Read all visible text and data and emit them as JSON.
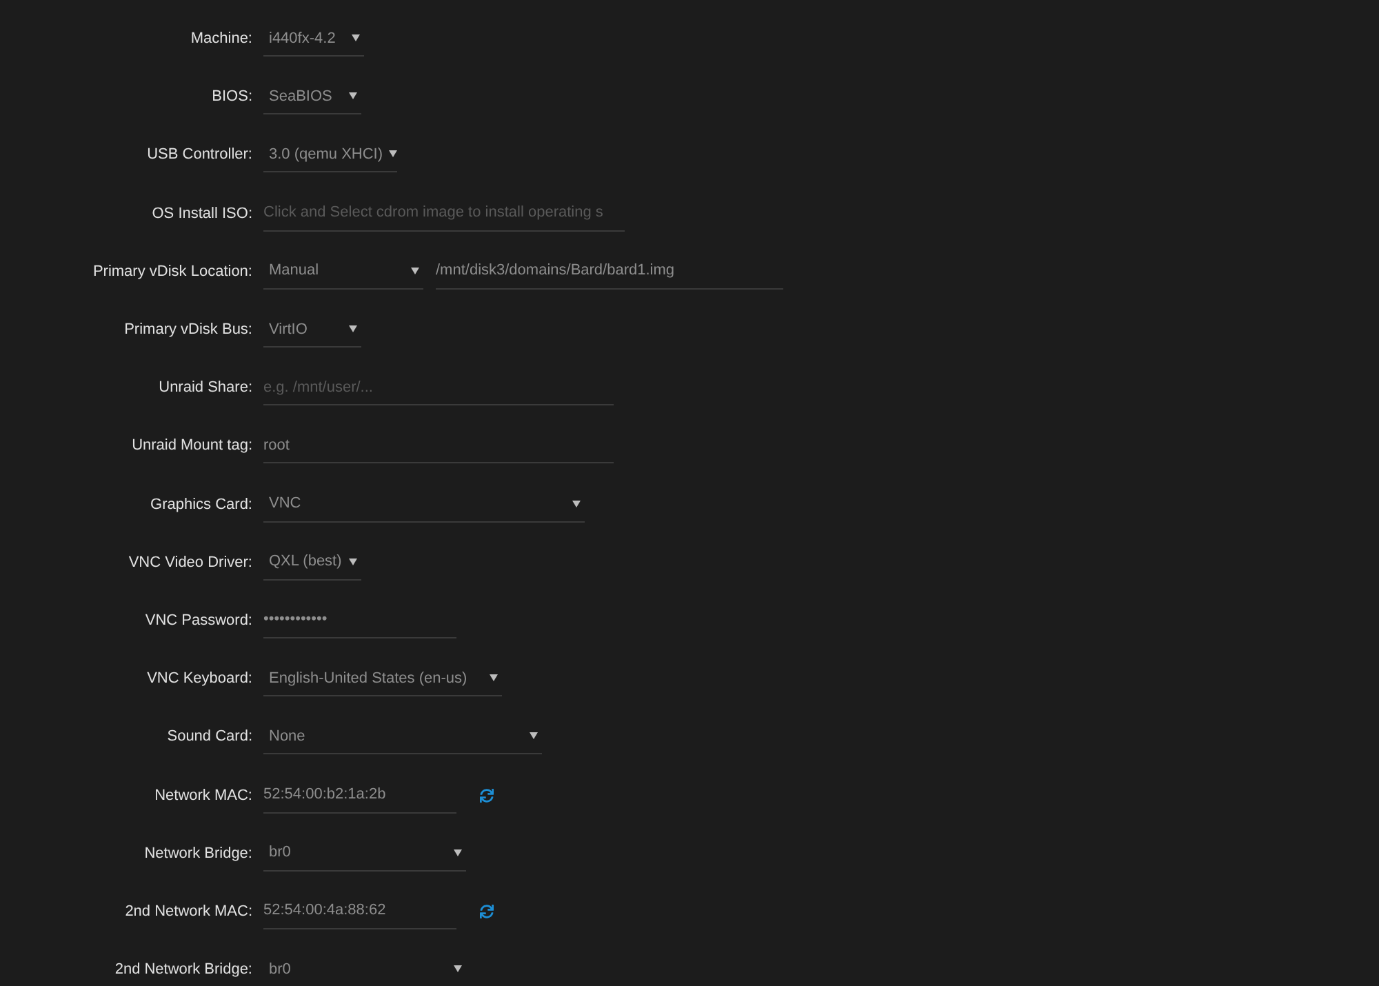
{
  "fields": [
    {
      "label": "Machine:",
      "kind": "select",
      "value": "i440fx-4.2"
    },
    {
      "label": "BIOS:",
      "kind": "select",
      "value": "SeaBIOS"
    },
    {
      "label": "USB Controller:",
      "kind": "select",
      "value": "3.0 (qemu XHCI)"
    },
    {
      "label": "OS Install ISO:",
      "kind": "text",
      "placeholder": "Click and Select cdrom image to install operating s"
    },
    {
      "label": "Primary vDisk Location:",
      "kind": "select_path",
      "value": "Manual",
      "path": "/mnt/disk3/domains/Bard/bard1.img"
    },
    {
      "label": "Primary vDisk Bus:",
      "kind": "select",
      "value": "VirtIO"
    },
    {
      "label": "Unraid Share:",
      "kind": "text",
      "placeholder": "e.g. /mnt/user/..."
    },
    {
      "label": "Unraid Mount tag:",
      "kind": "text",
      "value": "root"
    },
    {
      "label": "Graphics Card:",
      "kind": "select",
      "value": "VNC"
    },
    {
      "label": "VNC Video Driver:",
      "kind": "select",
      "value": "QXL (best)"
    },
    {
      "label": "VNC Password:",
      "kind": "text",
      "value": "••••••••••••"
    },
    {
      "label": "VNC Keyboard:",
      "kind": "select",
      "value": "English-United States (en-us)"
    },
    {
      "label": "Sound Card:",
      "kind": "select",
      "value": "None"
    },
    {
      "label": "Network MAC:",
      "kind": "text_refresh",
      "value": "52:54:00:b2:1a:2b"
    },
    {
      "label": "Network Bridge:",
      "kind": "select",
      "value": "br0"
    },
    {
      "label": "2nd Network MAC:",
      "kind": "text_refresh",
      "value": "52:54:00:4a:88:62"
    },
    {
      "label": "2nd Network Bridge:",
      "kind": "select",
      "value": "br0"
    }
  ]
}
